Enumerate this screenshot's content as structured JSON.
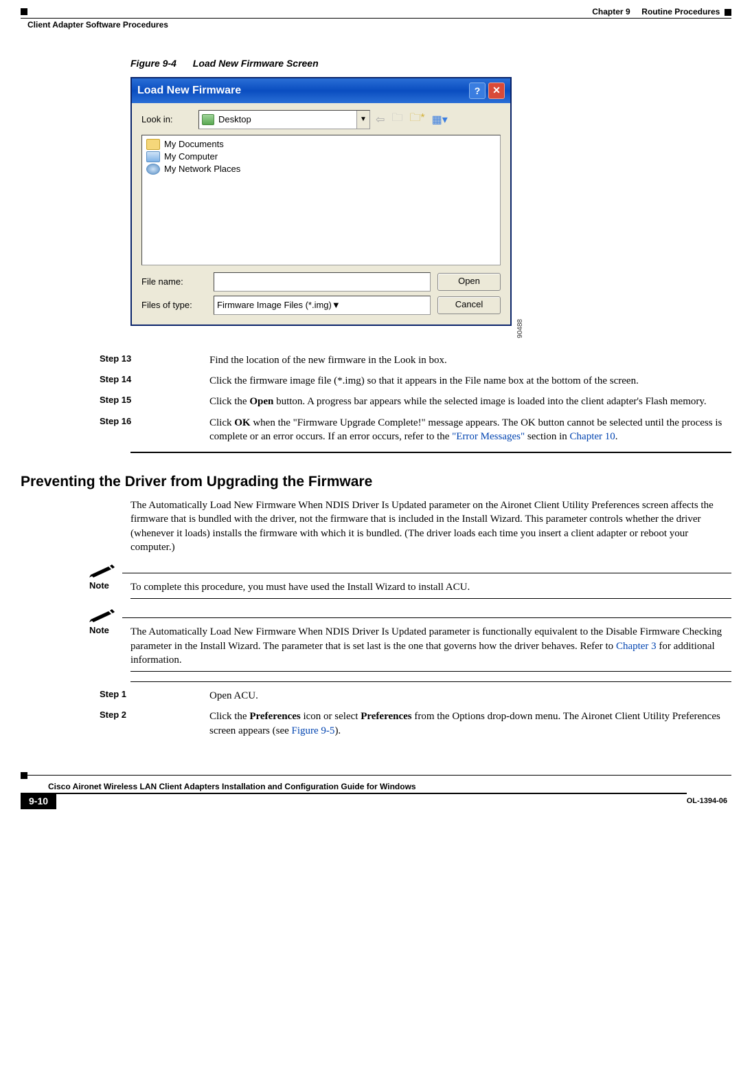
{
  "header": {
    "chapter_label": "Chapter 9",
    "chapter_title": "Routine Procedures",
    "section_title": "Client Adapter Software Procedures"
  },
  "figure": {
    "number": "Figure 9-4",
    "title": "Load New Firmware Screen",
    "side_label": "90488"
  },
  "dialog": {
    "title": "Load New Firmware",
    "help_btn": "?",
    "close_btn": "✕",
    "look_in_label": "Look in:",
    "look_in_value": "Desktop",
    "nav": {
      "back": "←",
      "up": "📄",
      "newfolder": "📂*",
      "views": "▥▾"
    },
    "items": [
      {
        "icon": "folder",
        "label": "My Documents"
      },
      {
        "icon": "comp",
        "label": "My Computer"
      },
      {
        "icon": "net",
        "label": "My Network Places"
      }
    ],
    "file_name_label": "File name:",
    "file_name_value": "",
    "file_type_label": "Files of type:",
    "file_type_value": "Firmware Image Files (*.img)",
    "open_btn": "Open",
    "cancel_btn": "Cancel"
  },
  "steps_a": [
    {
      "label": "Step 13",
      "text": "Find the location of the new firmware in the Look in box."
    },
    {
      "label": "Step 14",
      "text": "Click the firmware image file (*.img) so that it appears in the File name box at the bottom of the screen."
    },
    {
      "label": "Step 15",
      "pre": "Click the ",
      "bold": "Open",
      "post": " button. A progress bar appears while the selected image is loaded into the client adapter's Flash memory."
    },
    {
      "label": "Step 16",
      "pre": "Click ",
      "bold": "OK",
      "mid": " when the \"Firmware Upgrade Complete!\" message appears. The OK button cannot be selected until the process is complete or an error occurs. If an error occurs, refer to the ",
      "link1": "\"Error Messages\"",
      "mid2": " section in ",
      "link2": "Chapter 10",
      "post": "."
    }
  ],
  "section2": {
    "heading": "Preventing the Driver from Upgrading the Firmware",
    "para": "The Automatically Load New Firmware When NDIS Driver Is Updated parameter on the Aironet Client Utility Preferences screen affects the firmware that is bundled with the driver, not the firmware that is included in the Install Wizard. This parameter controls whether the driver (whenever it loads) installs the firmware with which it is bundled. (The driver loads each time you insert a client adapter or reboot your computer.)"
  },
  "note1": {
    "label": "Note",
    "text": "To complete this procedure, you must have used the Install Wizard to install ACU."
  },
  "note2": {
    "label": "Note",
    "pre": "The Automatically Load New Firmware When NDIS Driver Is Updated parameter is functionally equivalent to the Disable Firmware Checking parameter in the Install Wizard. The parameter that is set last is the one that governs how the driver behaves. Refer to ",
    "link": "Chapter 3",
    "post": " for additional information."
  },
  "steps_b": [
    {
      "label": "Step 1",
      "text": "Open ACU."
    },
    {
      "label": "Step 2",
      "pre": "Click the ",
      "bold1": "Preferences",
      "mid1": " icon or select ",
      "bold2": "Preferences",
      "mid2": " from the Options drop-down menu. The Aironet Client Utility Preferences screen appears (see ",
      "link": "Figure 9-5",
      "post": ")."
    }
  ],
  "footer": {
    "book_title": "Cisco Aironet Wireless LAN Client Adapters Installation and Configuration Guide for Windows",
    "page_num": "9-10",
    "doc_id": "OL-1394-06"
  }
}
